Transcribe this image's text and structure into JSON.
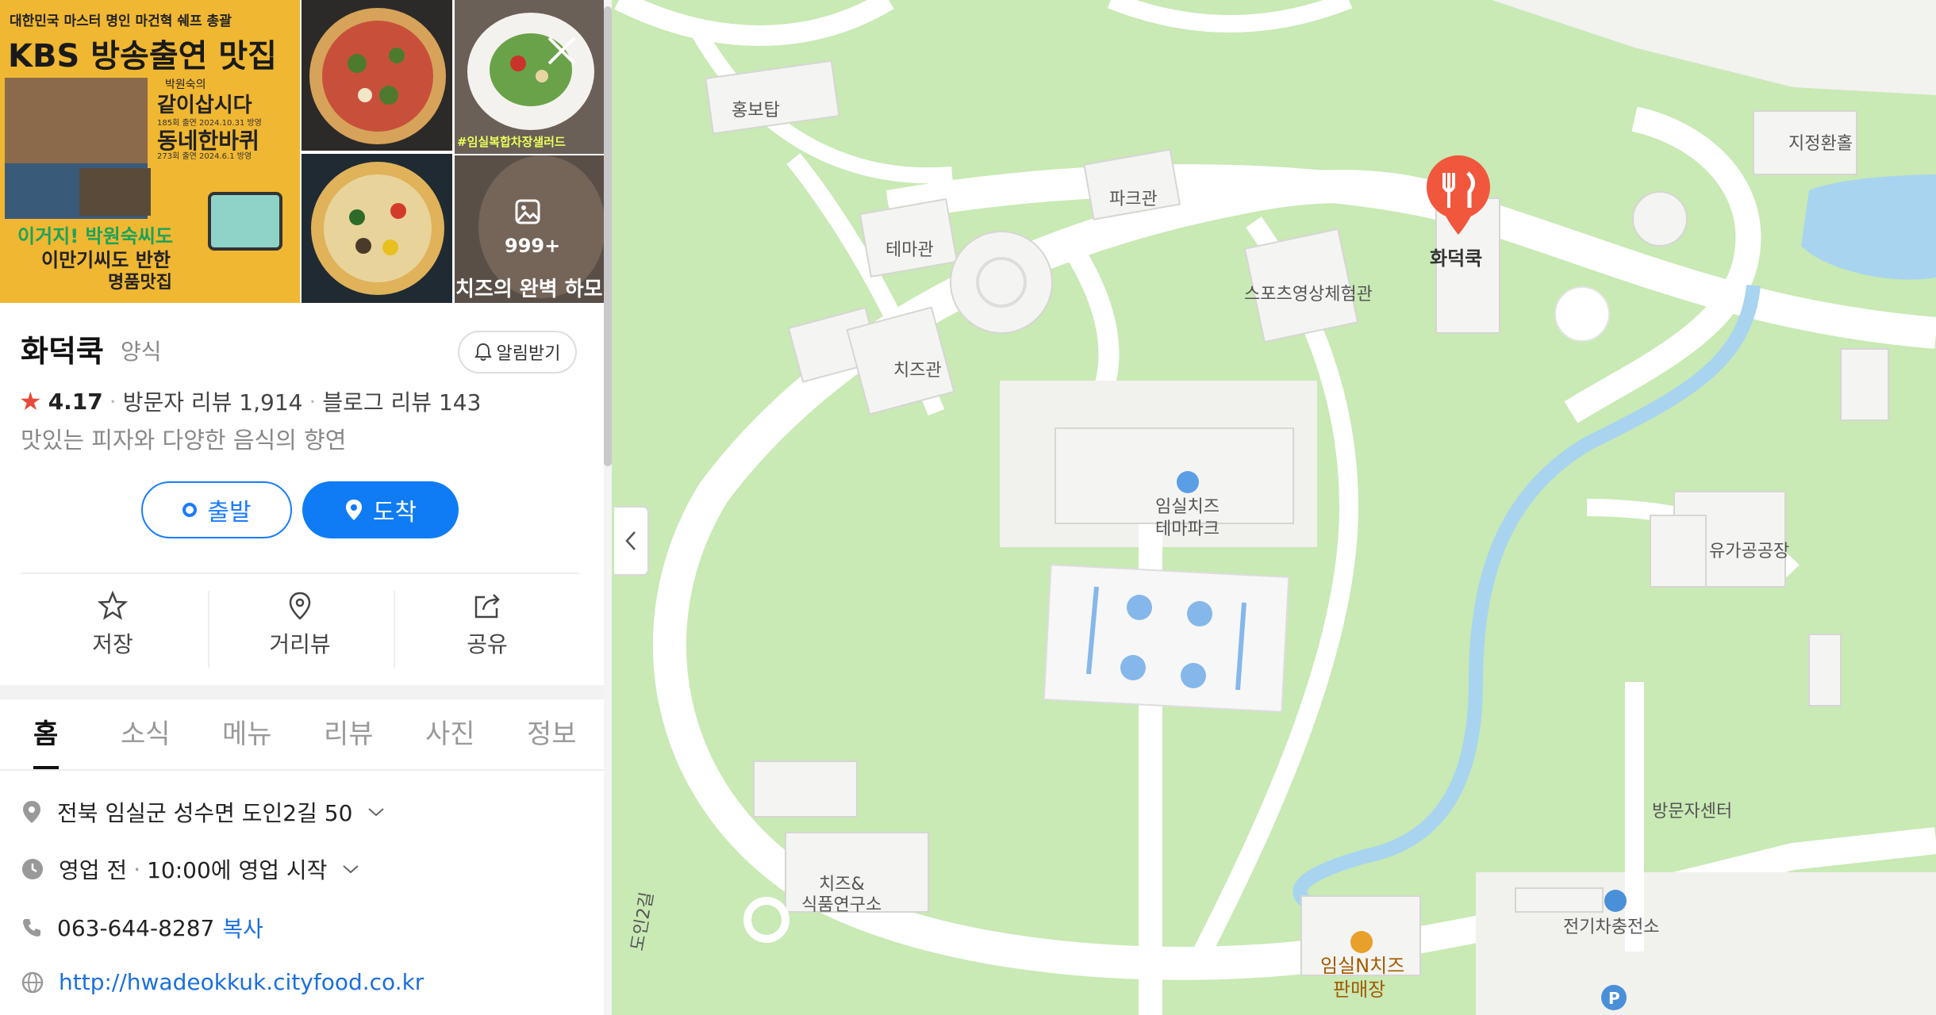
{
  "place": {
    "name": "화덕쿡",
    "category": "양식",
    "rating": "4.17",
    "visitor_reviews": "방문자 리뷰 1,914",
    "blog_reviews": "블로그 리뷰 143",
    "description": "맛있는 피자와 다양한 음식의 향연",
    "alarm_label": "알림받기"
  },
  "photos": {
    "banner_top": "대한민국 마스터 명인 마건혁 쉐프 총괄",
    "banner_title": "KBS 방송출연 맛집",
    "banner_show1_small": "박원숙의",
    "banner_show1": "같이삽시다",
    "banner_show1_date": "185회 출연 2024.10.31 방영",
    "banner_show2": "동네한바퀴",
    "banner_show2_date": "273회 출연 2024.6.1 방영",
    "banner_slogan1": "이거지! 박원숙씨도",
    "banner_slogan2": "이만기씨도 반한",
    "banner_slogan3": "명품맛집",
    "salad_caption": "#임실복합차장샐러드",
    "cheese_caption": "치즈의 완벽 하모",
    "more_count": "999+"
  },
  "route": {
    "start_label": "출발",
    "arrive_label": "도착"
  },
  "actions": {
    "save": "저장",
    "street_view": "거리뷰",
    "share": "공유"
  },
  "tabs": [
    "홈",
    "소식",
    "메뉴",
    "리뷰",
    "사진",
    "정보"
  ],
  "info": {
    "address": "전북 임실군 성수면 도인2길 50",
    "hours_status": "영업 전",
    "hours_detail": "10:00에 영업 시작",
    "phone": "063-644-8287",
    "copy_label": "복사",
    "website": "http://hwadeokkuk.cityfood.co.kr"
  },
  "map": {
    "labels": {
      "promo_tower": "홍보탑",
      "park_hall": "파크관",
      "theme_hall": "테마관",
      "cheese_hall": "치즈관",
      "sports_hall": "스포츠영상체험관",
      "restaurant": "화덕쿡",
      "roundabout": "지정환홀",
      "theme_park_1": "임실치즈",
      "theme_park_2": "테마파크",
      "dairy_factory": "유가공공장",
      "visitor_center": "방문자센터",
      "lab_1": "치즈&",
      "lab_2": "식품연구소",
      "ev_station": "전기차충전소",
      "shop_1": "임실N치즈",
      "shop_2": "판매장",
      "road_name": "도인2길"
    },
    "colors": {
      "grass": "#c9e9b5",
      "road": "#ffffff",
      "water": "#a8d4f0",
      "marker": "#f0573c"
    }
  }
}
